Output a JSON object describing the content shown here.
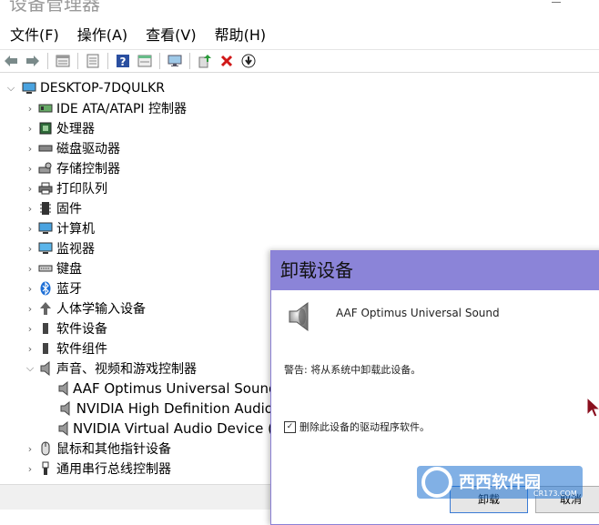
{
  "window": {
    "title": "设备管理器"
  },
  "menu": [
    "文件(F)",
    "操作(A)",
    "查看(V)",
    "帮助(H)"
  ],
  "toolbar": {
    "buttons": [
      "back-arrow-icon",
      "forward-arrow-icon",
      "properties-icon",
      "update-driver-icon",
      "help-icon",
      "view-icon",
      "monitor-icon",
      "add-driver-icon",
      "uninstall-x-icon",
      "download-icon"
    ]
  },
  "tree": {
    "root": "DESKTOP-7DQULKR",
    "categories": [
      {
        "label": "IDE ATA/ATAPI 控制器",
        "icon": "ide-controller-icon"
      },
      {
        "label": "处理器",
        "icon": "processor-icon"
      },
      {
        "label": "磁盘驱动器",
        "icon": "disk-drive-icon"
      },
      {
        "label": "存储控制器",
        "icon": "storage-controller-icon"
      },
      {
        "label": "打印队列",
        "icon": "printer-icon"
      },
      {
        "label": "固件",
        "icon": "firmware-icon"
      },
      {
        "label": "计算机",
        "icon": "computer-icon"
      },
      {
        "label": "监视器",
        "icon": "monitor-icon"
      },
      {
        "label": "键盘",
        "icon": "keyboard-icon"
      },
      {
        "label": "蓝牙",
        "icon": "bluetooth-icon"
      },
      {
        "label": "人体学输入设备",
        "icon": "hid-icon"
      },
      {
        "label": "软件设备",
        "icon": "software-device-icon"
      },
      {
        "label": "软件组件",
        "icon": "software-component-icon"
      },
      {
        "label": "声音、视频和游戏控制器",
        "icon": "speaker-icon",
        "expanded": true
      },
      {
        "label": "鼠标和其他指针设备",
        "icon": "mouse-icon"
      },
      {
        "label": "通用串行总线控制器",
        "icon": "usb-icon"
      }
    ],
    "sound_children": [
      "AAF Optimus Universal Sound",
      "NVIDIA High Definition Audio",
      "NVIDIA Virtual Audio Device ("
    ]
  },
  "dialog": {
    "title": "卸载设备",
    "device_name": "AAF Optimus Universal Sound",
    "warning": "警告: 将从系统中卸载此设备。",
    "checkbox_label": "删除此设备的驱动程序软件。",
    "checkbox_checked": "✓",
    "btn_uninstall": "卸载",
    "btn_cancel": "取消"
  },
  "watermark": {
    "brand": "西西软件园",
    "url": "CR173.COM"
  },
  "colors": {
    "dialog_header": "#8b84d8",
    "accent": "#3a7bd5"
  }
}
